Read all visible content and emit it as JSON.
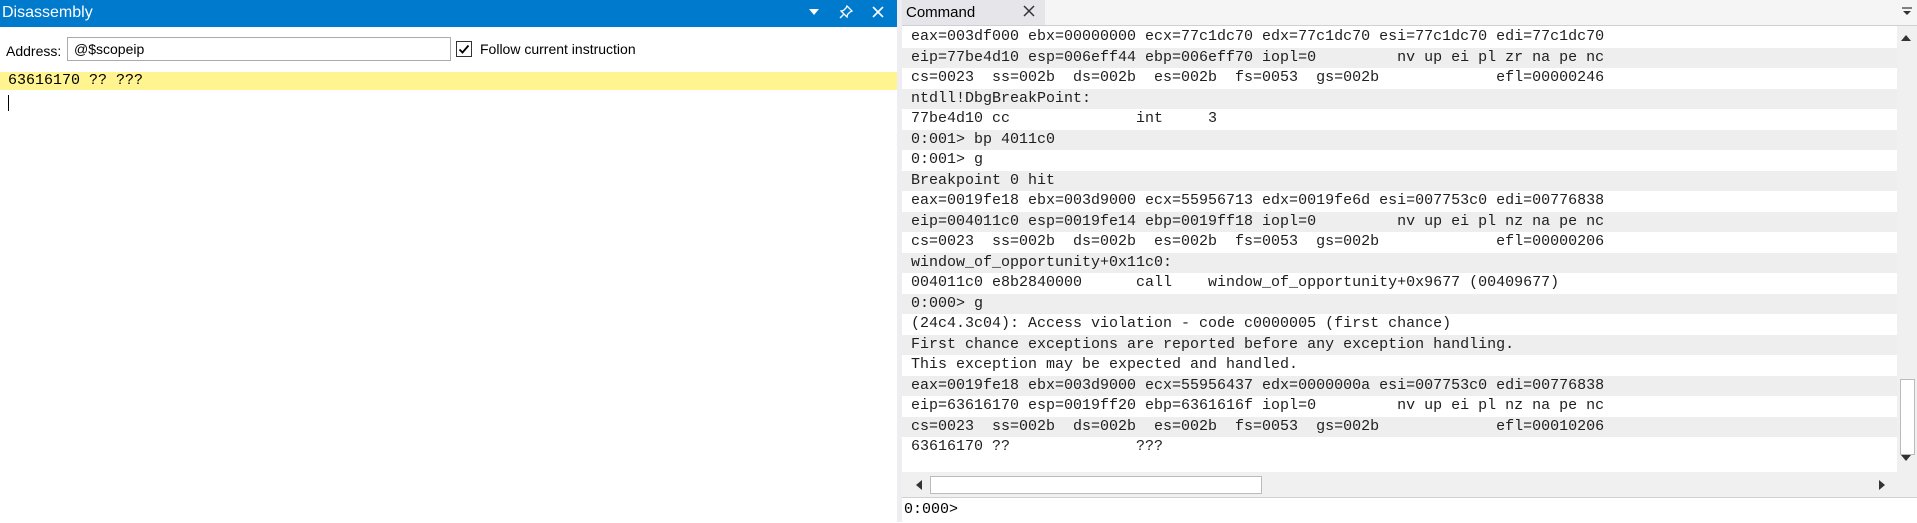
{
  "disassembly": {
    "title": "Disassembly",
    "address_label": "Address:",
    "address_value": "@$scopeip",
    "follow_label": "Follow current instruction",
    "follow_checked": true,
    "current_line": "63616170 ?? ???"
  },
  "command": {
    "tab_label": "Command",
    "prompt": "0:000>",
    "lines": [
      "eax=003df000 ebx=00000000 ecx=77c1dc70 edx=77c1dc70 esi=77c1dc70 edi=77c1dc70",
      "eip=77be4d10 esp=006eff44 ebp=006eff70 iopl=0         nv up ei pl zr na pe nc",
      "cs=0023  ss=002b  ds=002b  es=002b  fs=0053  gs=002b             efl=00000246",
      "ntdll!DbgBreakPoint:",
      "77be4d10 cc              int     3",
      "0:001> bp 4011c0",
      "0:001> g",
      "Breakpoint 0 hit",
      "eax=0019fe18 ebx=003d9000 ecx=55956713 edx=0019fe6d esi=007753c0 edi=00776838",
      "eip=004011c0 esp=0019fe14 ebp=0019ff18 iopl=0         nv up ei pl nz na pe nc",
      "cs=0023  ss=002b  ds=002b  es=002b  fs=0053  gs=002b             efl=00000206",
      "window_of_opportunity+0x11c0:",
      "004011c0 e8b2840000      call    window_of_opportunity+0x9677 (00409677)",
      "0:000> g",
      "(24c4.3c04): Access violation - code c0000005 (first chance)",
      "First chance exceptions are reported before any exception handling.",
      "This exception may be expected and handled.",
      "eax=0019fe18 ebx=003d9000 ecx=55956437 edx=0000000a esi=007753c0 edi=00776838",
      "eip=63616170 esp=0019ff20 ebp=6361616f iopl=0         nv up ei pl nz na pe nc",
      "cs=0023  ss=002b  ds=002b  es=002b  fs=0053  gs=002b             efl=00010206",
      "63616170 ??              ???"
    ]
  },
  "icons": {
    "dropdown": "chevron-down-icon",
    "pin": "pin-icon",
    "close": "close-icon",
    "scroll_up": "arrow-up-icon",
    "scroll_down": "arrow-down-icon",
    "scroll_left": "arrow-left-icon",
    "scroll_right": "arrow-right-icon"
  },
  "colors": {
    "title_bar": "#007acc",
    "highlight": "#fff48f",
    "alt_row": "#eeeeee"
  }
}
